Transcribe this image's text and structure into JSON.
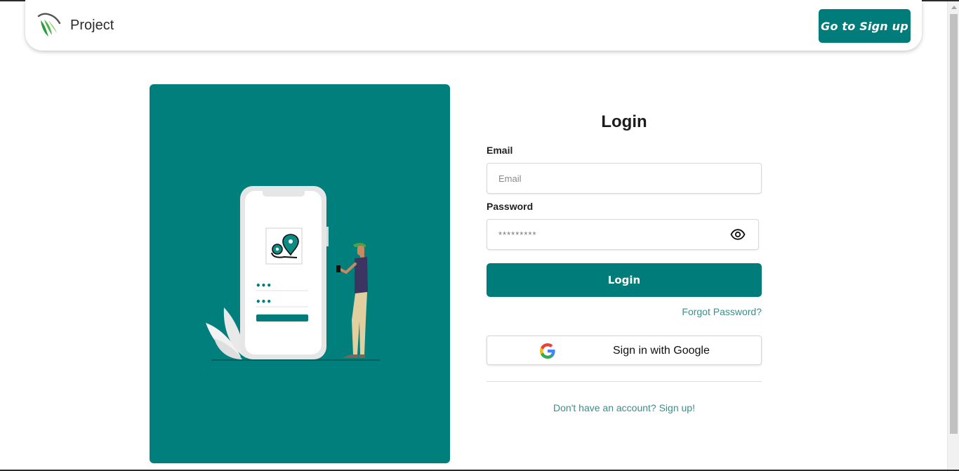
{
  "header": {
    "brand_name": "Project",
    "signup_button": "Go to Sign up"
  },
  "form": {
    "title": "Login",
    "email_label": "Email",
    "email_placeholder": "Email",
    "password_label": "Password",
    "password_placeholder": "*********",
    "login_button": "Login",
    "forgot_link": "Forgot Password?",
    "google_button": "Sign in with Google",
    "signup_link": "Don't have an account? Sign up!"
  },
  "illustration": {
    "phone_password_dots": [
      "•••",
      "•••"
    ]
  },
  "colors": {
    "primary": "#007d7b",
    "panel": "#007f7d",
    "link": "#3a8e8b"
  },
  "icons": {
    "brand": "leaf-logo-icon",
    "password_toggle": "eye-icon",
    "google": "google-icon"
  }
}
